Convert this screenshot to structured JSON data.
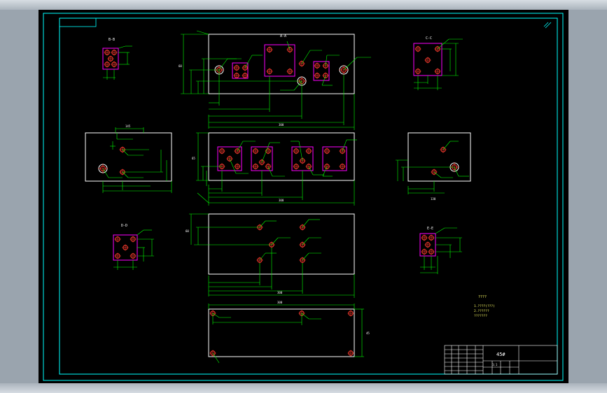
{
  "drawing": {
    "title_block": {
      "part_number": "45#",
      "ratio": "1:1"
    },
    "notes": {
      "heading": "????",
      "line1": "1.????(???)",
      "line2": "2.??????",
      "line3": "???????"
    },
    "section_labels": {
      "a": "A-A",
      "b": "B-B",
      "c": "C-C",
      "d": "D-D",
      "e": "E-E"
    },
    "dims": {
      "top_width": "300",
      "top_height": "60",
      "mid_width": "300",
      "mid_height": "65",
      "plate_width": "300",
      "plate_height": "60",
      "bottom_width": "300",
      "bottom_height": "45",
      "side_left_w": "145",
      "side_right_w": "130",
      "d1": "40",
      "d2": "65",
      "d3": "120",
      "d4": "157.5",
      "d5": "185",
      "d6": "214",
      "d7": "16",
      "d8": "25"
    },
    "colors": {
      "frame": "#00ffff",
      "outline": "#ffffff",
      "dimension": "#00ff00",
      "flange": "#ff00ff",
      "hole": "#ff3b2f",
      "background": "#000000"
    }
  }
}
